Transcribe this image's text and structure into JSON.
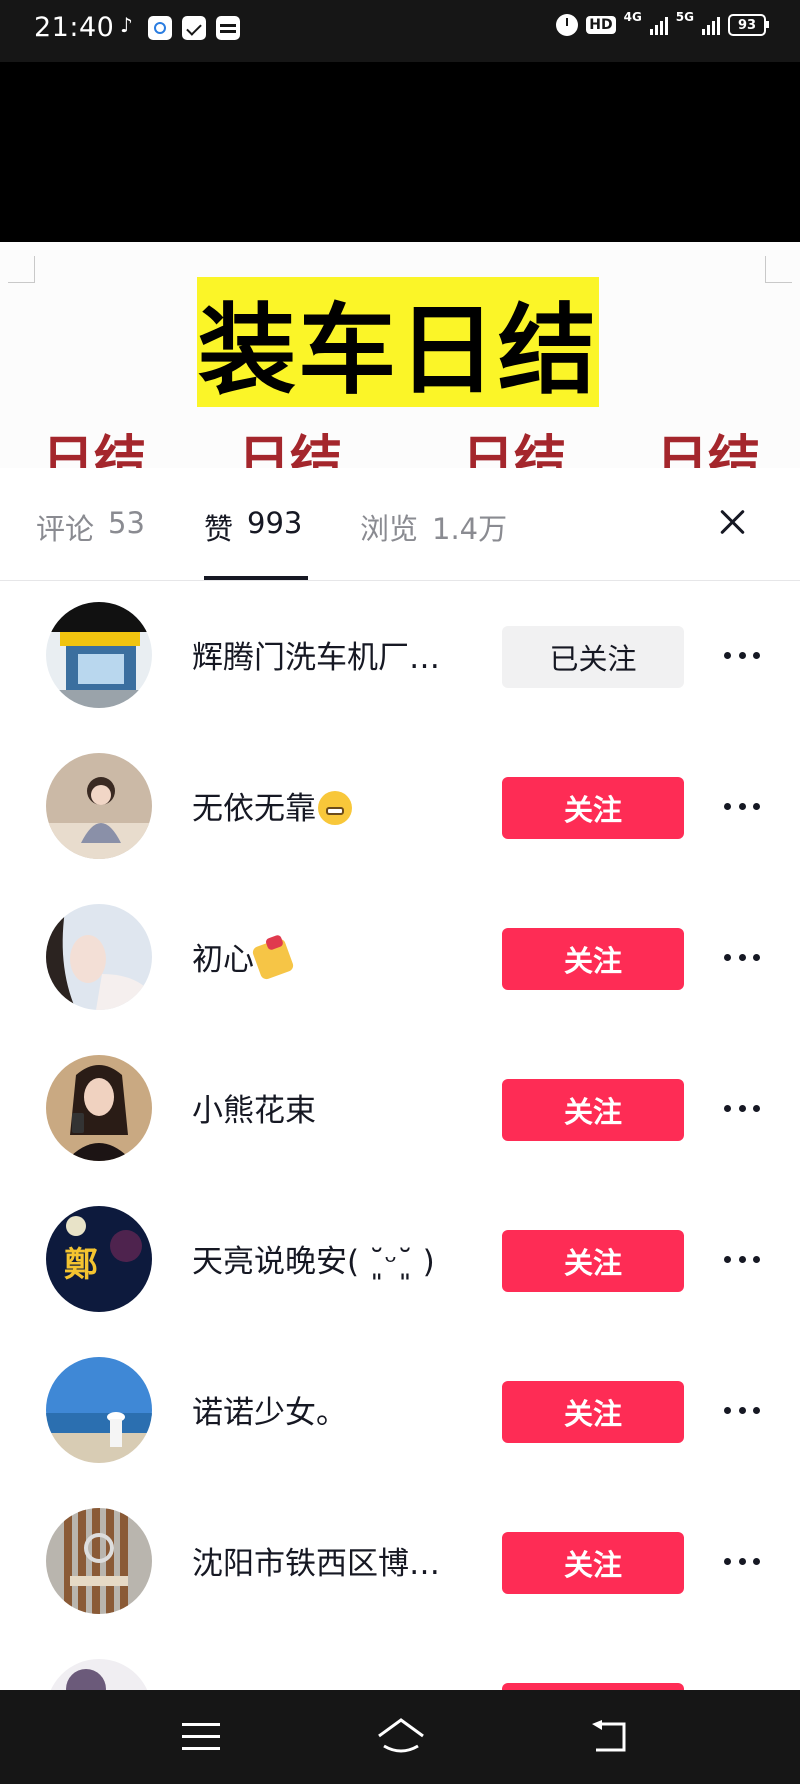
{
  "status_bar": {
    "time": "21:40",
    "hd": "HD",
    "net1": "4G",
    "net2": "5G",
    "battery": "93",
    "icons": [
      "tiktok-icon",
      "app-icon",
      "mail-icon",
      "card-icon",
      "alarm-icon",
      "signal-icon",
      "battery-icon"
    ]
  },
  "video": {
    "headline": "装车日结",
    "red_words": [
      "日结",
      "日结",
      "日结",
      "日结"
    ]
  },
  "tabs": [
    {
      "label": "评论",
      "count": "53"
    },
    {
      "label": "赞",
      "count": "993"
    },
    {
      "label": "浏览",
      "count": "1.4万"
    }
  ],
  "active_tab": "赞",
  "users": [
    {
      "name": "辉腾门洗车机厂…",
      "button": "已关注",
      "state": "following"
    },
    {
      "name": "无依无靠",
      "emoji": "grimacing-emoji-icon",
      "button": "关注",
      "state": "follow"
    },
    {
      "name": "初心",
      "emoji": "nail-polish-emoji-icon",
      "button": "关注",
      "state": "follow"
    },
    {
      "name": "小熊花束",
      "button": "关注",
      "state": "follow"
    },
    {
      "name": "天亮说晚安( ˘͈ᵕ˘͈ )",
      "button": "关注",
      "state": "follow"
    },
    {
      "name": "诺诺少女。",
      "button": "关注",
      "state": "follow"
    },
    {
      "name": "沈阳市铁西区博…",
      "button": "关注",
      "state": "follow"
    }
  ],
  "colors": {
    "accent": "#fe2c55",
    "following_bg": "#f1f1f2",
    "text": "#161823",
    "muted": "#8a8b91",
    "headline_bg": "#fbf528",
    "red_text": "#a4262c"
  }
}
